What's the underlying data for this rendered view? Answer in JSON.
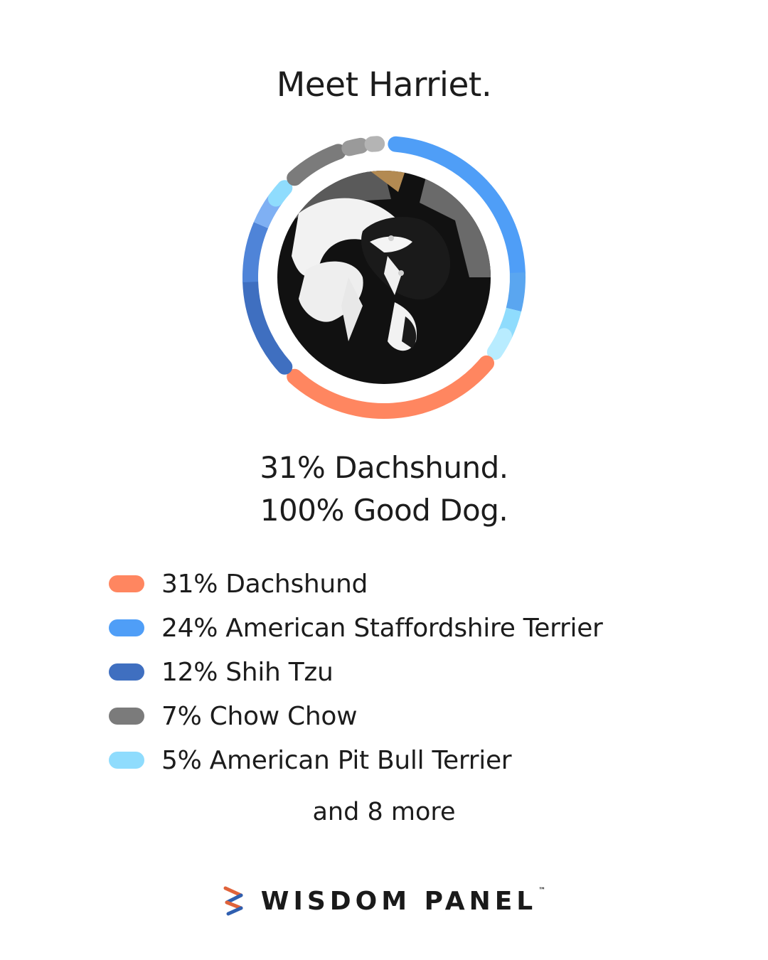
{
  "header": {
    "title": "Meet Harriet."
  },
  "tagline": {
    "line1": "31% Dachshund.",
    "line2": "100% Good Dog."
  },
  "chart_data": {
    "type": "pie",
    "style": "donut",
    "series": [
      {
        "name": "Dachshund",
        "label": "31% Dachshund",
        "value": 31,
        "color": "#ff8660"
      },
      {
        "name": "American Staffordshire Terrier",
        "label": "24% American Staffordshire Terrier",
        "value": 24,
        "color": "#4f9ef7"
      },
      {
        "name": "Shih Tzu",
        "label": "12% Shih Tzu",
        "value": 12,
        "color": "#3f6fc0"
      },
      {
        "name": "Chow Chow",
        "label": "7% Chow Chow",
        "value": 7,
        "color": "#7b7b7b"
      },
      {
        "name": "American Pit Bull Terrier",
        "label": "5% American Pit Bull Terrier",
        "value": 5,
        "color": "#8fdcfd"
      }
    ],
    "more_text": "and 8 more",
    "legend_position": "bottom"
  },
  "colors": {
    "ring_blue_light": "#5aa6f0",
    "ring_cyan": "#b8ecff",
    "ring_mid_blue": "#4f84d8",
    "ring_periwinkle": "#7fb0f3",
    "ring_gray_light": "#b4b4b4",
    "ring_gray_mid": "#9a9a9a"
  },
  "photo": {
    "subject": "dog-photo"
  },
  "brand": {
    "name": "WISDOM PANEL",
    "tm": "™"
  }
}
